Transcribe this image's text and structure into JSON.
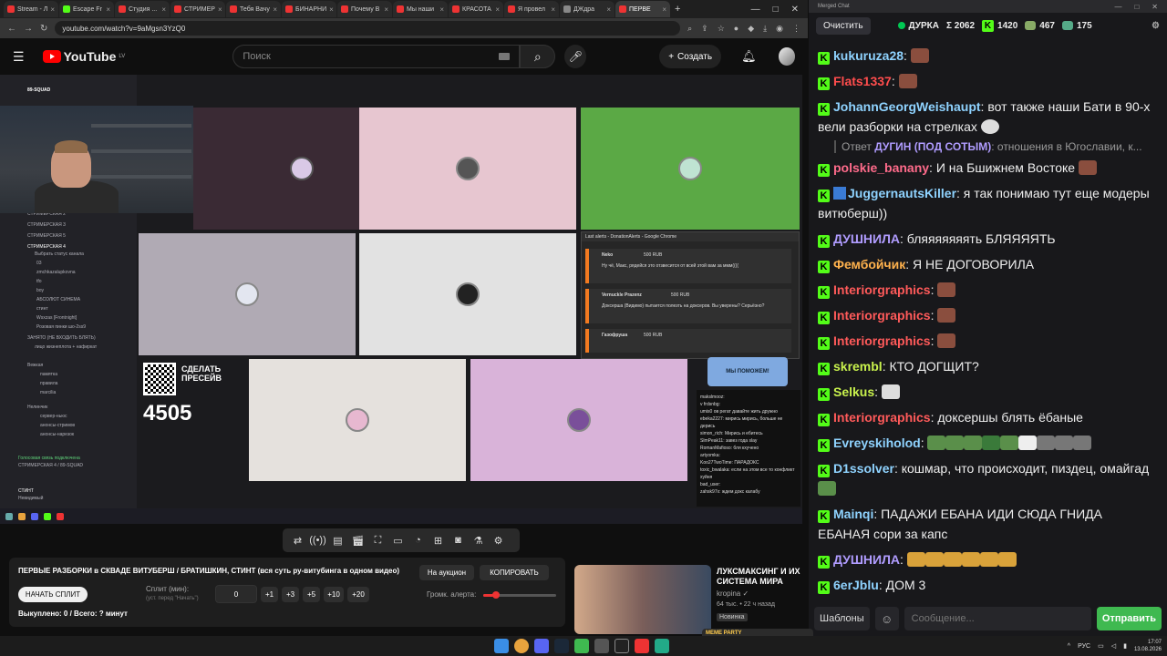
{
  "browser": {
    "tabs": [
      "Stream - Л",
      "Escape Fr",
      "Студия ...",
      "СТРИМЕР",
      "Тебя Вачу",
      "БИНАРНИ",
      "Почему В",
      "Мы наши",
      "КРАСОТА",
      "Я провел",
      "ДЖдра",
      "ПЕРВЕ"
    ],
    "url": "youtube.com/watch?v=9aMgsn3YzQ0"
  },
  "youtube": {
    "logo": "YouTube",
    "region": "LV",
    "search_placeholder": "Поиск",
    "create_label": "Создать"
  },
  "stream": {
    "discord_lines": [
      "89-SQUAD",
      "СТРИМЕРСКАЯ 2",
      "СТРИМЕРСКАЯ 3",
      "СТРИМЕРСКАЯ 5",
      "СТРИМЕРСКАЯ 4",
      "Выбрать статус канала",
      "03",
      "zmchkazalupkovna",
      "tfo",
      "boy",
      "АБСОЛЮТ СИНЕМА",
      "стинт",
      "Wsxzas [Frontnight]",
      "Розовая пинки шо-2ss9",
      "ЗАНЯТО (НЕ ВХОДИТЬ БЛЯТЬ)",
      "лицо жизнеплота + нафиркат",
      "Вежкая",
      "памятка",
      "правила",
      "marcilia",
      "Нелинчик",
      "сервер-ньюс",
      "анонсы-стримов",
      "анонсы-нарезок",
      "Голосовая связь подключена",
      "СТРИМЕРСКАЯ 4 / 89-SQUAD",
      "СТИНТ",
      "Невидимый"
    ],
    "qr_caption": "СДЕЛАТЬ ПРЕСЕЙВ",
    "qr_number": "4505",
    "donation_title": "Last alerts - DonationAlerts - Google Chrome",
    "donations": [
      {
        "name": "Neko",
        "amount": "500 RUB",
        "text": "Ну чё, Макс, рядейся это отзвесится от всей этой вам за ммм(((("
      },
      {
        "name": "Vernuckle Prazenz",
        "amount": "500 RUB",
        "text": "Доксерша (Видимо) пытается полезть на доксеров. Вы уверены? Серьёзно?"
      },
      {
        "name": "Газофруша",
        "amount": "500 RUB",
        "text": ""
      }
    ],
    "tw_banner": "МЫ ПОМОЖЕМ!",
    "tw_chat": [
      "makslmooz:",
      "v frdsnbg:",
      "umis0 ов регат давайте жить дружно",
      "ebeka2227: мирись мирись, больше не дерись",
      "simon_rich: Мирись и ебитесь",
      "SlmPeak11: завез года slay",
      "RomanMafioso: бля кхучено",
      "artyomka:",
      "Koo27TwoTime: ПАРАДОКС",
      "toxic_bwalaka: если на этом все то конфликт хуйня",
      "bad_user:",
      "zahsk97x: ждем докс калабу"
    ]
  },
  "controls": {
    "icons": [
      "shuffle-icon",
      "broadcast-icon",
      "card-icon",
      "clapper-icon",
      "crop-icon",
      "layout-icon",
      "gauge-icon",
      "add-window-icon",
      "camera-icon",
      "flask-icon",
      "gear-icon"
    ]
  },
  "info": {
    "title": "ПЕРВЫЕ РАЗБОРКИ в СКВАДЕ ВИТУБЕРШ / БРАТИШКИН, СТИНТ (вся суть ру-витубинга в одном видео)",
    "auction_label": "На аукцион",
    "copy_label": "КОПИРОВАТЬ",
    "start_label": "НАЧАТЬ СПЛИТ",
    "split_label": "Сплит (мин):",
    "split_sub": "(уст. перед \"Начать\")",
    "split_value": "0",
    "increments": [
      "+1",
      "+3",
      "+5",
      "+10",
      "+20"
    ],
    "volume_label": "Громк. алерта:",
    "volume_fraction": 0.17,
    "bought": "Выкуплено: 0 / Всего: ? минут"
  },
  "recommended": {
    "title": "ЛУКСМАКСИНГ И ИХ СИСТЕМА МИРА",
    "author": "kropina",
    "views": "64 тыс.",
    "age": "22 ч назад",
    "badge": "Новинка"
  },
  "chat": {
    "window_title": "Merged Chat",
    "clear_label": "Очистить",
    "channel": "ДУРКА",
    "sum": "Σ 2062",
    "kick_count": "1420",
    "stat2": "467",
    "stat3": "175",
    "messages": [
      {
        "nick": "kukuruza28",
        "color": "#8fd3ff",
        "text": ":"
      },
      {
        "nick": "Flats1337",
        "color": "#ff4d4d",
        "text": ":"
      },
      {
        "nick": "JohannGeorgWeishaupt",
        "color": "#8fd3ff",
        "text": ": вот также наши Бати в 90-х вели разборки на стрелках"
      },
      {
        "nick": "polskie_banany",
        "color": "#ff6b8b",
        "text": ": И на Бшижнем Востоке"
      },
      {
        "nick": "JuggernautsKiller",
        "color": "#8fd3ff",
        "text": ": я так понимаю тут еще модеры витюберш))"
      },
      {
        "nick": "ДУШНИЛА",
        "color": "#b09cff",
        "text": ": бляяяяяяять БЛЯЯЯЯТЬ"
      },
      {
        "nick": "Фембойчик",
        "color": "#ffb24d",
        "text": ": Я НЕ ДОГОВОРИЛА"
      },
      {
        "nick": "Interiorgraphics",
        "color": "#ff5a5a",
        "text": ":"
      },
      {
        "nick": "Interiorgraphics",
        "color": "#ff5a5a",
        "text": ":"
      },
      {
        "nick": "Interiorgraphics",
        "color": "#ff5a5a",
        "text": ":"
      },
      {
        "nick": "skrembl",
        "color": "#c9f24d",
        "text": ": КТО ДОГЩИТ?"
      },
      {
        "nick": "Selkus",
        "color": "#c9f24d",
        "text": ":"
      },
      {
        "nick": "Interiorgraphics",
        "color": "#ff5a5a",
        "text": ": доксершы блять ёбаные"
      },
      {
        "nick": "Evreyskiholod",
        "color": "#8fd3ff",
        "text": ":"
      },
      {
        "nick": "D1ssolver",
        "color": "#8fd3ff",
        "text": ": кошмар, что происходит, пиздец, омайгад"
      },
      {
        "nick": "Mainqi",
        "color": "#8fd3ff",
        "text": ": ПАДАЖИ ЕБАНА ИДИ СЮДА ГНИДА ЕБАНАЯ сори за капс"
      },
      {
        "nick": "ДУШНИЛА",
        "color": "#b09cff",
        "text": ":"
      },
      {
        "nick": "6erJblu",
        "color": "#8fd3ff",
        "text": ": ДОМ 3"
      }
    ],
    "reply": {
      "prefix": "Ответ",
      "nick": "ДУГИН (ПОД СОТЫМ)",
      "text": ": отношения в Югославии, к..."
    },
    "templates_label": "Шаблоны",
    "input_placeholder": "Сообщение...",
    "send_label": "Отправить"
  },
  "taskbar": {
    "lang": "РУС",
    "time": "17:07",
    "date": "13.08.2026",
    "media": "МЕМЕ PARTY"
  }
}
